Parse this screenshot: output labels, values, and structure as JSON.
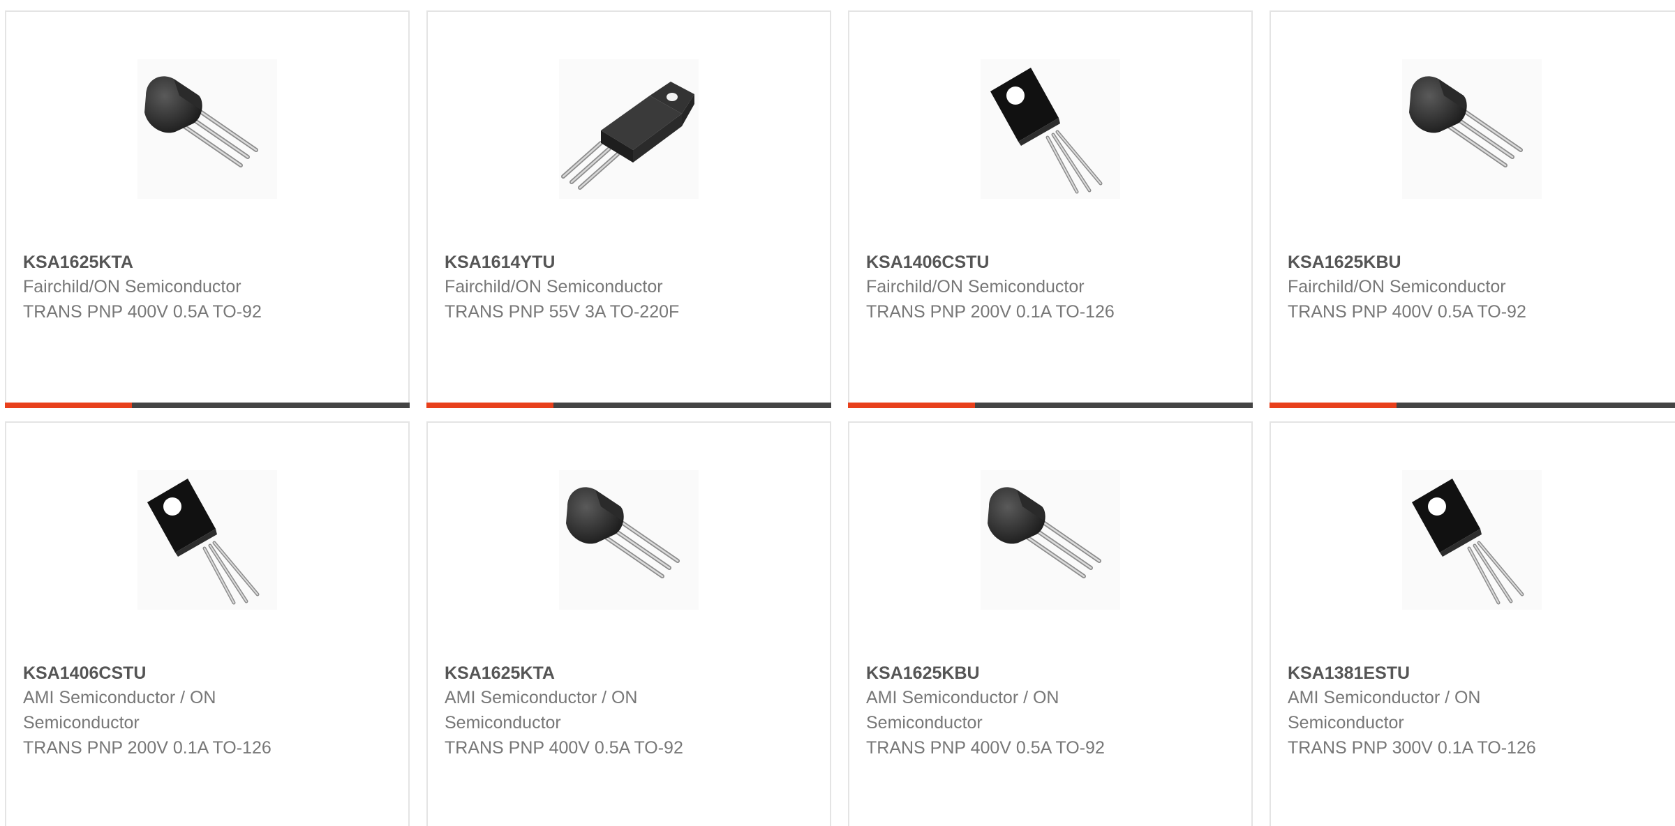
{
  "accent_color": "#e8401c",
  "bar_color": "#444444",
  "products": [
    {
      "part_number": "KSA1625KTA",
      "manufacturer": "Fairchild/ON Semiconductor",
      "description": "TRANS PNP 400V 0.5A TO-92",
      "image": "to-92-transistor-icon"
    },
    {
      "part_number": "KSA1614YTU",
      "manufacturer": "Fairchild/ON Semiconductor",
      "description": "TRANS PNP 55V 3A TO-220F",
      "image": "to-220f-transistor-icon"
    },
    {
      "part_number": "KSA1406CSTU",
      "manufacturer": "Fairchild/ON Semiconductor",
      "description": "TRANS PNP 200V 0.1A TO-126",
      "image": "to-126-transistor-icon"
    },
    {
      "part_number": "KSA1625KBU",
      "manufacturer": "Fairchild/ON Semiconductor",
      "description": "TRANS PNP 400V 0.5A TO-92",
      "image": "to-92-transistor-icon"
    },
    {
      "part_number": "KSA1406CSTU",
      "manufacturer": "AMI Semiconductor / ON Semiconductor",
      "description": "TRANS PNP 200V 0.1A TO-126",
      "image": "to-126-transistor-icon"
    },
    {
      "part_number": "KSA1625KTA",
      "manufacturer": "AMI Semiconductor / ON Semiconductor",
      "description": "TRANS PNP 400V 0.5A TO-92",
      "image": "to-92-transistor-icon"
    },
    {
      "part_number": "KSA1625KBU",
      "manufacturer": "AMI Semiconductor / ON Semiconductor",
      "description": "TRANS PNP 400V 0.5A TO-92",
      "image": "to-92-transistor-icon"
    },
    {
      "part_number": "KSA1381ESTU",
      "manufacturer": "AMI Semiconductor / ON Semiconductor",
      "description": "TRANS PNP 300V 0.1A TO-126",
      "image": "to-126-transistor-icon"
    }
  ]
}
